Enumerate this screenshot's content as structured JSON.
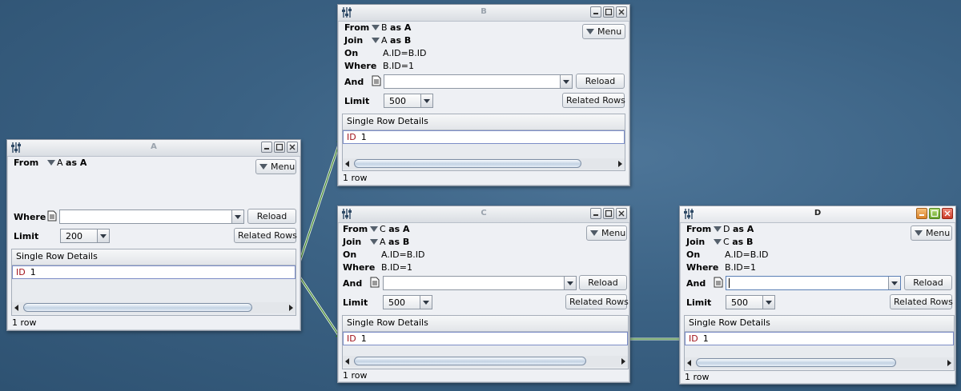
{
  "labels": {
    "from": "From",
    "join": "Join",
    "on": "On",
    "where": "Where",
    "and": "And",
    "limit": "Limit",
    "menu": "Menu",
    "reload": "Reload",
    "related_rows": "Related Rows",
    "single_row_details": "Single Row Details"
  },
  "windows": {
    "A": {
      "title": "A",
      "from_table": "A",
      "from_alias": "as A",
      "condition_placeholder": "",
      "limit": "200",
      "field": "ID",
      "value": "1",
      "status": "1 row"
    },
    "B": {
      "title": "B",
      "from_table": "B",
      "from_alias": "as A",
      "join_table": "A",
      "join_alias": "as B",
      "on": "A.ID=B.ID",
      "where": "B.ID=1",
      "limit": "500",
      "field": "ID",
      "value": "1",
      "status": "1 row"
    },
    "C": {
      "title": "C",
      "from_table": "C",
      "from_alias": "as A",
      "join_table": "A",
      "join_alias": "as B",
      "on": "A.ID=B.ID",
      "where": "B.ID=1",
      "limit": "500",
      "field": "ID",
      "value": "1",
      "status": "1 row"
    },
    "D": {
      "title": "D",
      "from_table": "D",
      "from_alias": "as A",
      "join_table": "C",
      "join_alias": "as B",
      "on": "A.ID=B.ID",
      "where": "B.ID=1",
      "limit": "500",
      "field": "ID",
      "value": "1",
      "status": "1 row"
    }
  },
  "colors": {
    "desktop": "#3b6284",
    "link_line": "#2e7d1e",
    "field_name": "#a0121b"
  }
}
